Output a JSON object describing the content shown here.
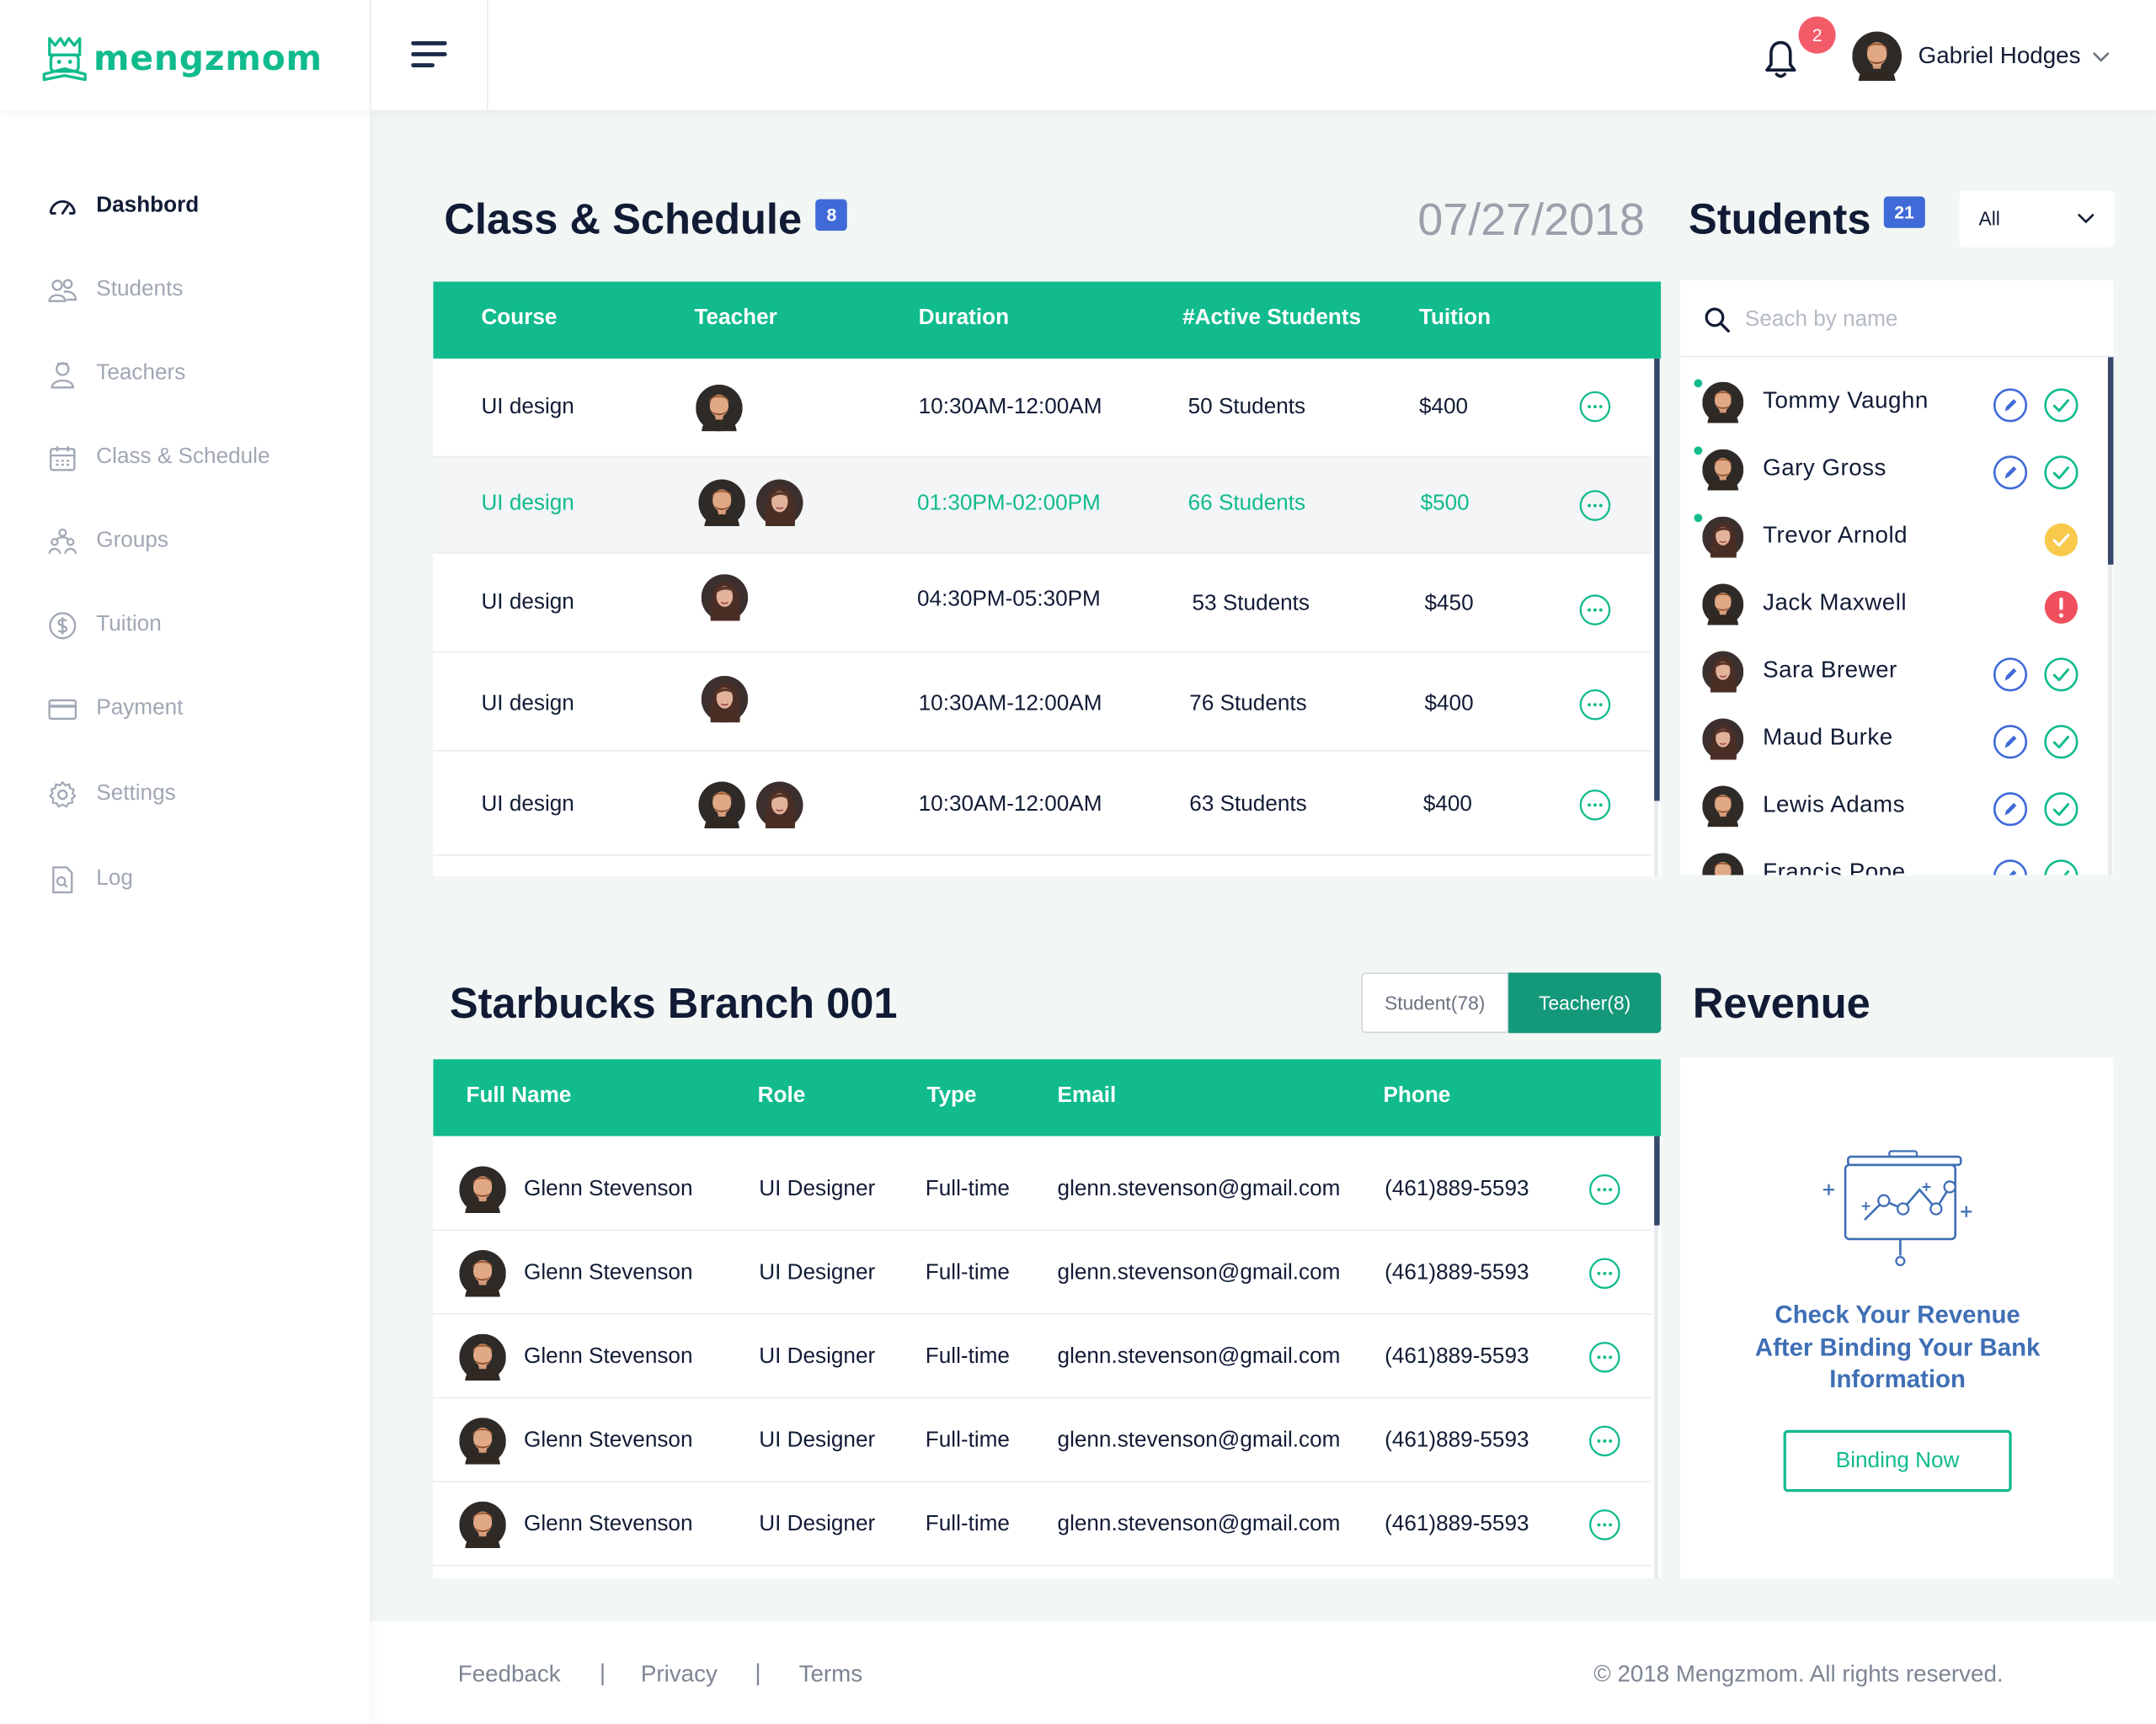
{
  "app": {
    "brand": "mengzmom"
  },
  "topbar": {
    "notification_count": "2",
    "user_name": "Gabriel Hodges"
  },
  "sidebar": {
    "items": [
      {
        "label": "Dashbord",
        "icon": "dashboard-icon",
        "active": true
      },
      {
        "label": "Students",
        "icon": "students-icon"
      },
      {
        "label": "Teachers",
        "icon": "teachers-icon"
      },
      {
        "label": "Class & Schedule",
        "icon": "calendar-icon"
      },
      {
        "label": "Groups",
        "icon": "groups-icon"
      },
      {
        "label": "Tuition",
        "icon": "dollar-icon"
      },
      {
        "label": "Payment",
        "icon": "credit-card-icon"
      },
      {
        "label": "Settings",
        "icon": "gear-icon"
      },
      {
        "label": "Log",
        "icon": "log-icon"
      }
    ]
  },
  "schedule": {
    "title": "Class & Schedule",
    "count": "8",
    "date": "07/27/2018",
    "columns": {
      "course": "Course",
      "teacher": "Teacher",
      "duration": "Duration",
      "active": "#Active Students",
      "tuition": "Tuition"
    },
    "rows": [
      {
        "course": "UI design",
        "duration": "10:30AM-12:00AM",
        "students": "50 Students",
        "tuition": "$400"
      },
      {
        "course": "UI design",
        "duration": "01:30PM-02:00PM",
        "students": "66 Students",
        "tuition": "$500"
      },
      {
        "course": "UI design",
        "duration": "04:30PM-05:30PM",
        "students": "53 Students",
        "tuition": "$450"
      },
      {
        "course": "UI design",
        "duration": "10:30AM-12:00AM",
        "students": "76 Students",
        "tuition": "$400"
      },
      {
        "course": "UI design",
        "duration": "10:30AM-12:00AM",
        "students": "63 Students",
        "tuition": "$400"
      }
    ]
  },
  "students": {
    "title": "Students",
    "count": "21",
    "filter": "All",
    "search_placeholder": "Seach by name",
    "list": [
      {
        "name": "Tommy Vaughn",
        "status": "edit-approve",
        "online": true
      },
      {
        "name": "Gary Gross",
        "status": "edit-approve",
        "online": true
      },
      {
        "name": "Trevor Arnold",
        "status": "done",
        "online": true
      },
      {
        "name": "Jack Maxwell",
        "status": "alert",
        "online": false
      },
      {
        "name": "Sara Brewer",
        "status": "edit-approve",
        "online": false
      },
      {
        "name": "Maud Burke",
        "status": "edit-approve",
        "online": false
      },
      {
        "name": "Lewis Adams",
        "status": "edit-approve",
        "online": false
      },
      {
        "name": "Francis Pope",
        "status": "edit-approve",
        "online": false
      }
    ]
  },
  "branch": {
    "title": "Starbucks Branch 001",
    "tabs": {
      "student": "Student(78)",
      "teacher": "Teacher(8)"
    },
    "active_tab": "teacher",
    "columns": {
      "name": "Full Name",
      "role": "Role",
      "type": "Type",
      "email": "Email",
      "phone": "Phone"
    },
    "rows": [
      {
        "name": "Glenn Stevenson",
        "role": "UI Designer",
        "type": "Full-time",
        "email": "glenn.stevenson@gmail.com",
        "phone": "(461)889-5593"
      },
      {
        "name": "Glenn Stevenson",
        "role": "UI Designer",
        "type": "Full-time",
        "email": "glenn.stevenson@gmail.com",
        "phone": "(461)889-5593"
      },
      {
        "name": "Glenn Stevenson",
        "role": "UI Designer",
        "type": "Full-time",
        "email": "glenn.stevenson@gmail.com",
        "phone": "(461)889-5593"
      },
      {
        "name": "Glenn Stevenson",
        "role": "UI Designer",
        "type": "Full-time",
        "email": "glenn.stevenson@gmail.com",
        "phone": "(461)889-5593"
      },
      {
        "name": "Glenn Stevenson",
        "role": "UI Designer",
        "type": "Full-time",
        "email": "glenn.stevenson@gmail.com",
        "phone": "(461)889-5593"
      }
    ]
  },
  "revenue": {
    "title": "Revenue",
    "message_line1": "Check Your Revenue",
    "message_line2": "After Binding Your Bank",
    "message_line3": "Information",
    "button": "Binding Now"
  },
  "footer": {
    "feedback": "Feedback",
    "privacy": "Privacy",
    "terms": "Terms",
    "separator": "|",
    "copyright": "© 2018 Mengzmom. All rights reserved."
  },
  "colors": {
    "primary": "#11bb8d",
    "badge_blue": "#3f6ad8",
    "notification": "#f45b69",
    "text_dark": "#111b35",
    "muted": "#a0a7b4",
    "tab_active": "#14987a"
  }
}
